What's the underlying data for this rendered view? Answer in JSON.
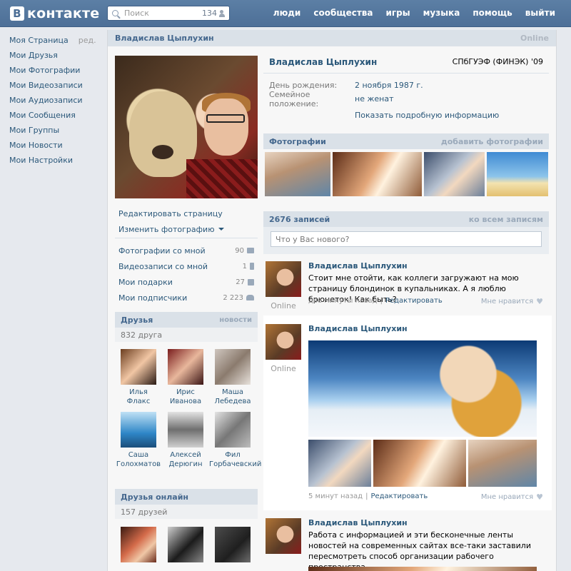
{
  "header": {
    "logo_letter": "В",
    "logo_text": "контакте",
    "search_placeholder": "Поиск",
    "search_count": "134",
    "nav": [
      "люди",
      "сообщества",
      "игры",
      "музыка",
      "помощь",
      "выйти"
    ]
  },
  "left_menu": {
    "items": [
      "Моя Страница",
      "Мои Друзья",
      "Мои Фотографии",
      "Мои Видеозаписи",
      "Мои Аудиозаписи",
      "Мои Сообщения",
      "Мои Группы",
      "Мои Новости",
      "Мои Настройки"
    ],
    "edit_label": "ред."
  },
  "profile": {
    "name": "Владислав Цыплухин",
    "status": "Online",
    "university": "СПбГУЭФ (ФИНЭК) '09",
    "birthday_label": "День рождения:",
    "birthday_value": "2 ноября 1987 г.",
    "family_label": "Семейное положение:",
    "family_value": "не женат",
    "more_info": "Показать подробную информацию"
  },
  "profile_links": {
    "edit_page": "Редактировать страницу",
    "change_photo": "Изменить фотографию"
  },
  "counters": [
    {
      "label": "Фотографии со мной",
      "value": "90",
      "icon": "camera-icon"
    },
    {
      "label": "Видеозаписи со мной",
      "value": "1",
      "icon": "video-icon"
    },
    {
      "label": "Мои подарки",
      "value": "27",
      "icon": "gift-icon"
    },
    {
      "label": "Мои подписчики",
      "value": "2 223",
      "icon": "people-icon"
    }
  ],
  "friends_block": {
    "title": "Друзья",
    "right": "новости",
    "count": "832 друга",
    "friends": [
      {
        "first": "Илья",
        "last": "Флакс"
      },
      {
        "first": "Ирис",
        "last": "Иванова"
      },
      {
        "first": "Маша",
        "last": "Лебедева"
      },
      {
        "first": "Саша",
        "last": "Голохматов"
      },
      {
        "first": "Алексей",
        "last": "Дерюгин"
      },
      {
        "first": "Фил",
        "last": "Горбачевский"
      }
    ]
  },
  "online_block": {
    "title": "Друзья онлайн",
    "count": "157 друзей"
  },
  "photos_block": {
    "title": "Фотографии",
    "action": "добавить фотографии"
  },
  "wall": {
    "title": "2676 записей",
    "action": "ко всем записям",
    "placeholder": "Что у Вас нового?",
    "posts": [
      {
        "author": "Владислав Цыплухин",
        "text": "Стоит мне отойти, как коллеги загружают на мою страницу блондинок в купальниках. А я люблю брюнеток! Как быть?",
        "time": "две минуты назад",
        "edit": "Редактировать",
        "like": "Мне нравится",
        "status": "Online"
      },
      {
        "author": "Владислав Цыплухин",
        "time": "5 минут назад",
        "edit": "Редактировать",
        "like": "Мне нравится",
        "status": "Online"
      },
      {
        "author": "Владислав Цыплухин",
        "text": "Работа с информацией и эти бесконечные ленты новостей на современных сайтах все-таки заставили пересмотреть способ организации рабочего пространства."
      }
    ]
  },
  "colors": {
    "header": "#4d6f97",
    "link": "#2b587a",
    "block_header": "#dae1e8",
    "page_bg": "#e6e9ee"
  }
}
